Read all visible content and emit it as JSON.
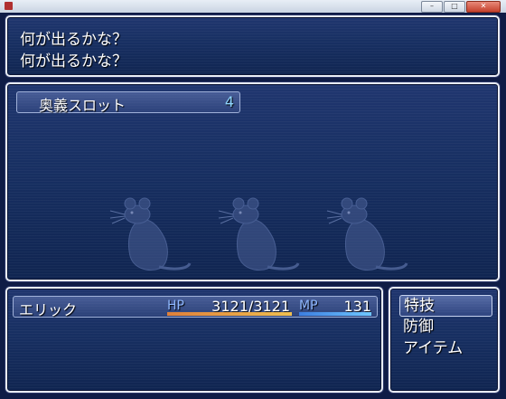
{
  "message": {
    "lines": [
      "何が出るかな？",
      "何が出るかな？"
    ]
  },
  "battle": {
    "skill": {
      "name": "奥義スロット",
      "count": "4"
    },
    "enemies": [
      {
        "icon": "rat-icon"
      },
      {
        "icon": "rat-icon"
      },
      {
        "icon": "rat-icon"
      }
    ]
  },
  "status": {
    "actor": {
      "name": "エリック",
      "hp_label": "HP",
      "hp_value": "3121/3121",
      "hp_ratio": 1.0,
      "mp_label": "MP",
      "mp_value": "131",
      "mp_ratio": 1.0
    }
  },
  "commands": [
    "特技",
    "防御",
    "アイテム"
  ],
  "selected_command": "特技",
  "colors": {
    "window_bg": "#183063",
    "hp_gauge": "#f0a040",
    "mp_gauge": "#4aa0f0",
    "accent_text": "#8fd6ff"
  }
}
